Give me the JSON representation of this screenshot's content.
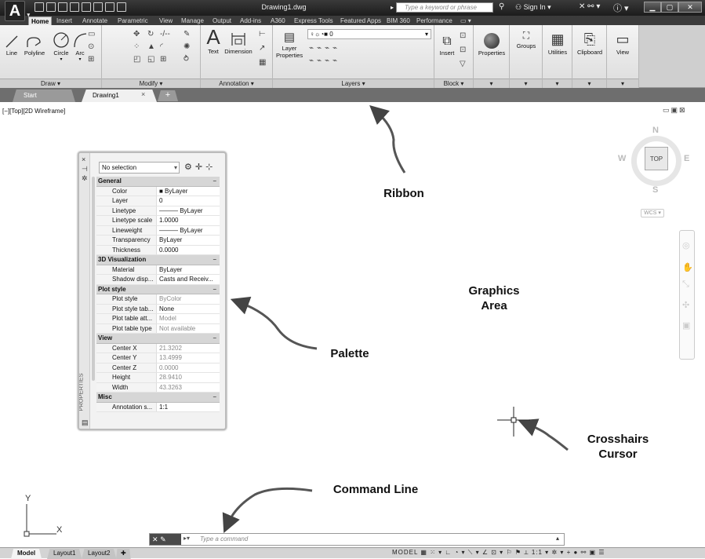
{
  "titlebar": {
    "doc_title": "Drawing1.dwg",
    "search_placeholder": "Type a keyword or phrase",
    "sign_in": "Sign In"
  },
  "ribbon_tabs": [
    "Home",
    "Insert",
    "Annotate",
    "Parametric",
    "View",
    "Manage",
    "Output",
    "Add-ins",
    "A360",
    "Express Tools",
    "Featured Apps",
    "BIM 360",
    "Performance"
  ],
  "ribbon": {
    "draw": {
      "title": "Draw ▾",
      "tools": [
        "Line",
        "Polyline",
        "Circle",
        "Arc"
      ]
    },
    "modify": {
      "title": "Modify ▾"
    },
    "annotation": {
      "title": "Annotation ▾",
      "tools": [
        "Text",
        "Dimension"
      ]
    },
    "layers": {
      "title": "Layers ▾",
      "layer_props_1": "Layer",
      "layer_props_2": "Properties",
      "current_layer": "0"
    },
    "block": {
      "title": "Block ▾",
      "insert": "Insert"
    },
    "properties": {
      "label": "Properties"
    },
    "groups": {
      "label": "Groups"
    },
    "utilities": {
      "label": "Utilities"
    },
    "clipboard": {
      "label": "Clipboard"
    },
    "view": {
      "label": "View"
    }
  },
  "file_tabs": {
    "start": "Start",
    "drawing": "Drawing1"
  },
  "viewport_label": "[−][Top][2D Wireframe]",
  "viewcube": {
    "top": "TOP",
    "n": "N",
    "s": "S",
    "e": "E",
    "w": "W",
    "wcs": "WCS ▾"
  },
  "palette": {
    "selection": "No selection",
    "vertical_title": "PROPERTIES",
    "categories": [
      {
        "name": "General",
        "rows": [
          {
            "k": "Color",
            "v": "■ ByLayer"
          },
          {
            "k": "Layer",
            "v": "0"
          },
          {
            "k": "Linetype",
            "v": "——— ByLayer"
          },
          {
            "k": "Linetype scale",
            "v": "1.0000"
          },
          {
            "k": "Lineweight",
            "v": "——— ByLayer"
          },
          {
            "k": "Transparency",
            "v": "ByLayer"
          },
          {
            "k": "Thickness",
            "v": "0.0000"
          }
        ]
      },
      {
        "name": "3D Visualization",
        "rows": [
          {
            "k": "Material",
            "v": "ByLayer"
          },
          {
            "k": "Shadow disp...",
            "v": "Casts and Receiv..."
          }
        ]
      },
      {
        "name": "Plot style",
        "rows": [
          {
            "k": "Plot style",
            "v": "ByColor",
            "dim": true
          },
          {
            "k": "Plot style tab...",
            "v": "None"
          },
          {
            "k": "Plot table att...",
            "v": "Model",
            "dim": true
          },
          {
            "k": "Plot table type",
            "v": "Not available",
            "dim": true
          }
        ]
      },
      {
        "name": "View",
        "rows": [
          {
            "k": "Center X",
            "v": "21.3202",
            "dim": true
          },
          {
            "k": "Center Y",
            "v": "13.4999",
            "dim": true
          },
          {
            "k": "Center Z",
            "v": "0.0000",
            "dim": true
          },
          {
            "k": "Height",
            "v": "28.9410",
            "dim": true
          },
          {
            "k": "Width",
            "v": "43.3263",
            "dim": true
          }
        ]
      },
      {
        "name": "Misc",
        "rows": [
          {
            "k": "Annotation s...",
            "v": "1:1"
          }
        ]
      }
    ]
  },
  "annotations": {
    "ribbon": "Ribbon",
    "graphics_1": "Graphics",
    "graphics_2": "Area",
    "palette": "Palette",
    "crosshairs_1": "Crosshairs",
    "crosshairs_2": "Cursor",
    "command_line": "Command Line"
  },
  "ucs": {
    "x": "X",
    "y": "Y"
  },
  "command_line": {
    "placeholder": "Type a command"
  },
  "layout_tabs": [
    "Model",
    "Layout1",
    "Layout2"
  ],
  "status": {
    "model": "MODEL",
    "scale": "1:1"
  }
}
